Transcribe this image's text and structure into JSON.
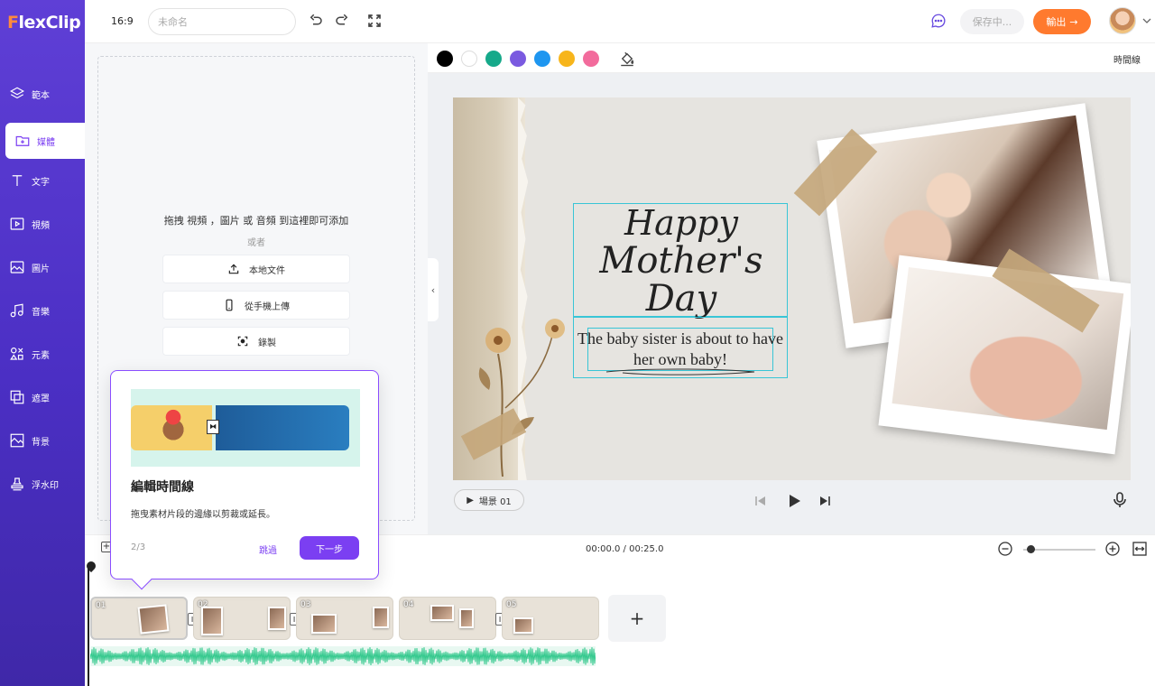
{
  "app": {
    "brand_f": "F",
    "brand_rest": "lexClip"
  },
  "sidebar": {
    "items": [
      {
        "label": "範本",
        "icon": "layers-icon"
      },
      {
        "label": "媒體",
        "icon": "media-folder-icon"
      },
      {
        "label": "文字",
        "icon": "text-icon"
      },
      {
        "label": "視頻",
        "icon": "video-icon"
      },
      {
        "label": "圖片",
        "icon": "image-icon"
      },
      {
        "label": "音樂",
        "icon": "music-icon"
      },
      {
        "label": "元素",
        "icon": "elements-icon"
      },
      {
        "label": "遮罩",
        "icon": "overlay-icon"
      },
      {
        "label": "背景",
        "icon": "background-icon"
      },
      {
        "label": "浮水印",
        "icon": "watermark-icon"
      }
    ],
    "active_index": 1
  },
  "header": {
    "ratio": "16:9",
    "title_placeholder": "未命名",
    "title_value": "",
    "save_status": "保存中...",
    "export_label": "輸出",
    "colors": {
      "accent": "#7b3ff2",
      "export": "#ff7a2e"
    }
  },
  "media": {
    "drop_text": "拖拽 視頻 ，圖片 或 音頻 到這裡即可添加",
    "or_text": "或者",
    "buttons": [
      "本地文件",
      "從手機上傳",
      "錄製"
    ]
  },
  "toolbar": {
    "swatches": [
      "#000000",
      "#ffffff",
      "#16a98a",
      "#7a5ae0",
      "#1e96f0",
      "#f7b51b",
      "#f26b9c"
    ],
    "timeline_label": "時間線"
  },
  "canvas": {
    "title_line1": "Happy",
    "title_line2": "Mother's Day",
    "body_text": "The baby sister is about to have her own baby!"
  },
  "player": {
    "scene_label": "場景 01"
  },
  "timeline": {
    "timecode": "00:00.0 / 00:25.0",
    "clips": [
      "01",
      "02",
      "03",
      "04",
      "05"
    ],
    "add_label": "+"
  },
  "tooltip": {
    "title": "編輯時間線",
    "description": "拖曳素材片段的邊緣以剪裁或延長。",
    "step": "2/3",
    "skip": "跳過",
    "next": "下一步"
  }
}
